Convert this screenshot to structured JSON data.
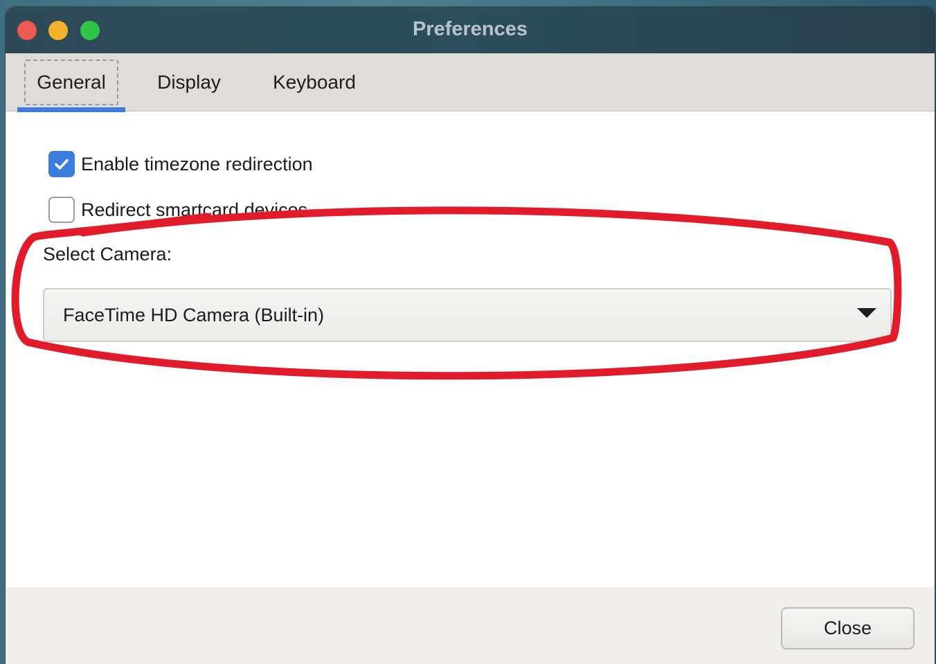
{
  "window": {
    "title": "Preferences"
  },
  "tabs": [
    {
      "label": "General",
      "selected": true
    },
    {
      "label": "Display",
      "selected": false
    },
    {
      "label": "Keyboard",
      "selected": false
    }
  ],
  "general": {
    "checkboxes": [
      {
        "label": "Enable timezone redirection",
        "checked": true
      },
      {
        "label": "Redirect smartcard devices",
        "checked": false
      }
    ],
    "camera": {
      "label": "Select Camera:",
      "selected_value": "FaceTime HD Camera (Built-in)"
    }
  },
  "footer": {
    "close_label": "Close"
  },
  "colors": {
    "accent": "#3b7ddd",
    "annotation": "#e11b2a",
    "close_light": "#ee5a52",
    "minimize_light": "#f5b22c",
    "zoom_light": "#2ec548"
  }
}
